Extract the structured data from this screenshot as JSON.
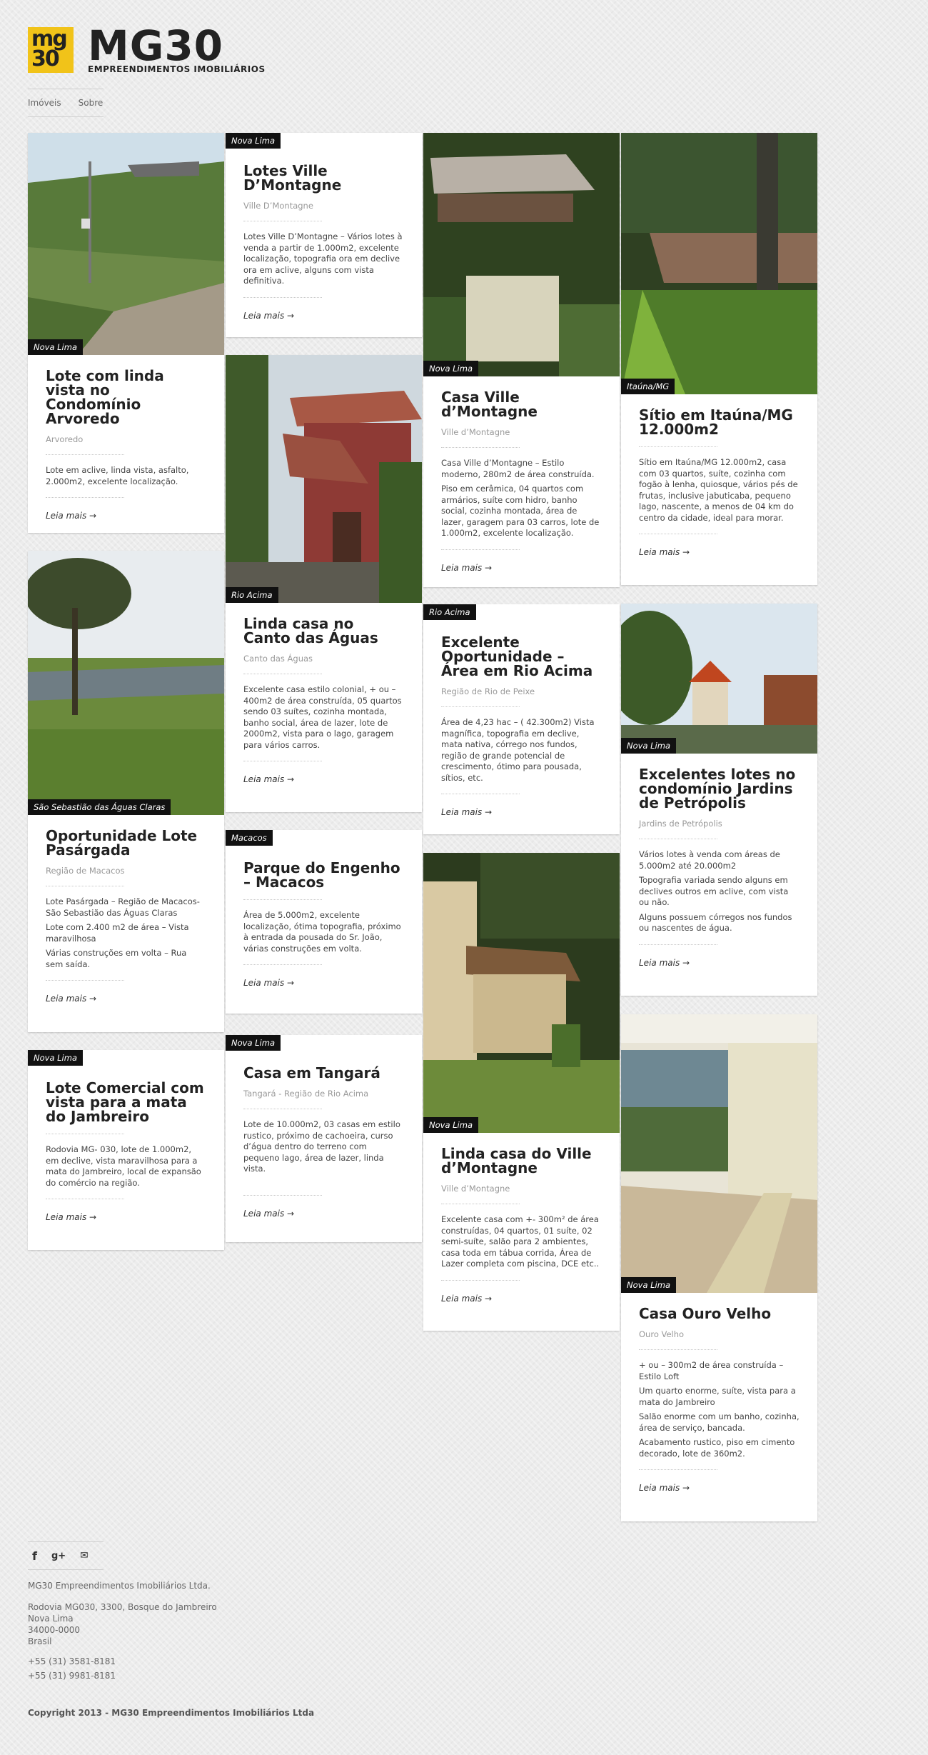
{
  "brand": {
    "title": "MG30",
    "subtitle": "EMPREENDIMENTOS IMOBILIÁRIOS",
    "logo_top": "mg",
    "logo_bottom": "30",
    "accent": "#f1c319"
  },
  "nav": {
    "imoveis": "Imóveis",
    "sobre": "Sobre"
  },
  "read_more": "Leia mais →",
  "cards": [
    {
      "tag": "Nova Lima",
      "title": "Lote com linda vista no Condomínio Arvoredo",
      "sub": "Arvoredo",
      "desc": [
        "Lote em aclive, linda vista, asfalto, 2.000m2, excelente localização."
      ]
    },
    {
      "tag": "São Sebastião das Águas Claras",
      "title": "Oportunidade Lote Pasárgada",
      "sub": "Região de Macacos",
      "desc": [
        "Lote Pasárgada – Região de Macacos-São Sebastião das Águas Claras",
        "Lote com 2.400 m2 de área – Vista maravilhosa",
        "Várias construções em volta – Rua sem saída."
      ]
    },
    {
      "tag": "Nova Lima",
      "title": "Lote Comercial com vista para a mata do Jambreiro",
      "sub": "",
      "desc": [
        "Rodovia MG- 030, lote de 1.000m2, em declive, vista maravilhosa para a mata do Jambreiro, local de expansão do comércio na região."
      ]
    },
    {
      "tag": "Nova Lima",
      "title": "Lotes Ville D’Montagne",
      "sub": "Ville D’Montagne",
      "desc": [
        "Lotes Ville D’Montagne – Vários lotes à venda a partir de 1.000m2, excelente localização, topografia ora em declive ora em aclive, alguns com vista definitiva."
      ]
    },
    {
      "tag": "Rio Acima",
      "title": "Linda casa no Canto das Águas",
      "sub": "Canto das Águas",
      "desc": [
        "Excelente casa estilo colonial, + ou – 400m2 de área construída, 05 quartos sendo 03 suítes, cozinha montada, banho social, área de lazer, lote de 2000m2, vista para o lago, garagem para vários carros."
      ]
    },
    {
      "tag": "Macacos",
      "title": "Parque do Engenho – Macacos",
      "sub": "",
      "desc": [
        "Área de 5.000m2, excelente localização, ótima topografia, próximo à entrada da pousada do Sr. João, várias construções em volta."
      ]
    },
    {
      "tag": "Nova Lima",
      "title": "Casa em Tangará",
      "sub": "Tangará - Região de Rio Acima",
      "desc": [
        "Lote de 10.000m2, 03 casas em estilo rustico, próximo de cachoeira, curso d’água dentro do terreno com pequeno lago, área de lazer, linda vista."
      ]
    },
    {
      "tag": "Nova Lima",
      "title": "Casa Ville d’Montagne",
      "sub": "Ville d’Montagne",
      "desc": [
        "Casa Ville d’Montagne – Estilo moderno, 280m2 de área construída.",
        "Piso em cerâmica, 04 quartos com armários, suíte com hidro, banho social, cozinha montada, área de lazer, garagem para 03 carros, lote de 1.000m2, excelente localização."
      ]
    },
    {
      "tag": "Rio Acima",
      "title": "Excelente Oportunidade – Área em Rio Acima",
      "sub": "Região de Rio de Peixe",
      "desc": [
        "Área de 4,23 hac – ( 42.300m2) Vista magnífica, topografia em declive, mata nativa, córrego nos fundos, região de grande potencial de crescimento, ótimo para pousada, sítios, etc."
      ]
    },
    {
      "tag": "Nova Lima",
      "title": "Linda casa do Ville d’Montagne",
      "sub": "Ville d’Montagne",
      "desc": [
        "Excelente casa com +- 300m² de área construídas, 04 quartos, 01 suíte, 02 semi-suíte, salão para 2 ambientes, casa toda em tábua corrida, Área de Lazer completa com piscina, DCE etc.."
      ]
    },
    {
      "tag": "Itaúna/MG",
      "title": "Sítio em Itaúna/MG 12.000m2",
      "sub": "",
      "desc": [
        "Sítio em Itaúna/MG 12.000m2, casa com 03 quartos, suíte, cozinha com fogão à lenha, quiosque, vários pés de frutas, inclusive jabuticaba, pequeno lago, nascente, a menos de 04 km do centro da cidade, ideal para morar."
      ]
    },
    {
      "tag": "Nova Lima",
      "title": "Excelentes lotes no condomínio Jardins de Petrópolis",
      "sub": "Jardins de Petrópolis",
      "desc": [
        "Vários lotes à venda com áreas de 5.000m2 até 20.000m2",
        "Topografia variada sendo alguns em declives outros em aclive, com vista ou não.",
        "Alguns possuem córregos nos fundos ou nascentes de água."
      ]
    },
    {
      "tag": "Nova Lima",
      "title": "Casa Ouro Velho",
      "sub": "Ouro Velho",
      "desc": [
        "+ ou – 300m2 de área construída – Estilo Loft",
        "Um quarto enorme, suíte, vista para a mata do Jambreiro",
        "Salão enorme com um banho, cozinha, área de serviço, bancada.",
        "Acabamento rustico, piso em cimento decorado, lote de 360m2."
      ]
    }
  ],
  "footer": {
    "company": "MG30 Empreendimentos Imobiliários Ltda.",
    "address": [
      "Rodovia MG030, 3300, Bosque do Jambreiro",
      "Nova Lima",
      "34000-0000",
      "Brasil"
    ],
    "phones": [
      "+55 (31) 3581-8181",
      "+55 (31) 9981-8181"
    ],
    "copyright": "Copyright 2013 - MG30 Empreendimentos Imobiliários Ltda",
    "icons": [
      "facebook-icon",
      "google-plus-icon",
      "email-icon"
    ]
  }
}
